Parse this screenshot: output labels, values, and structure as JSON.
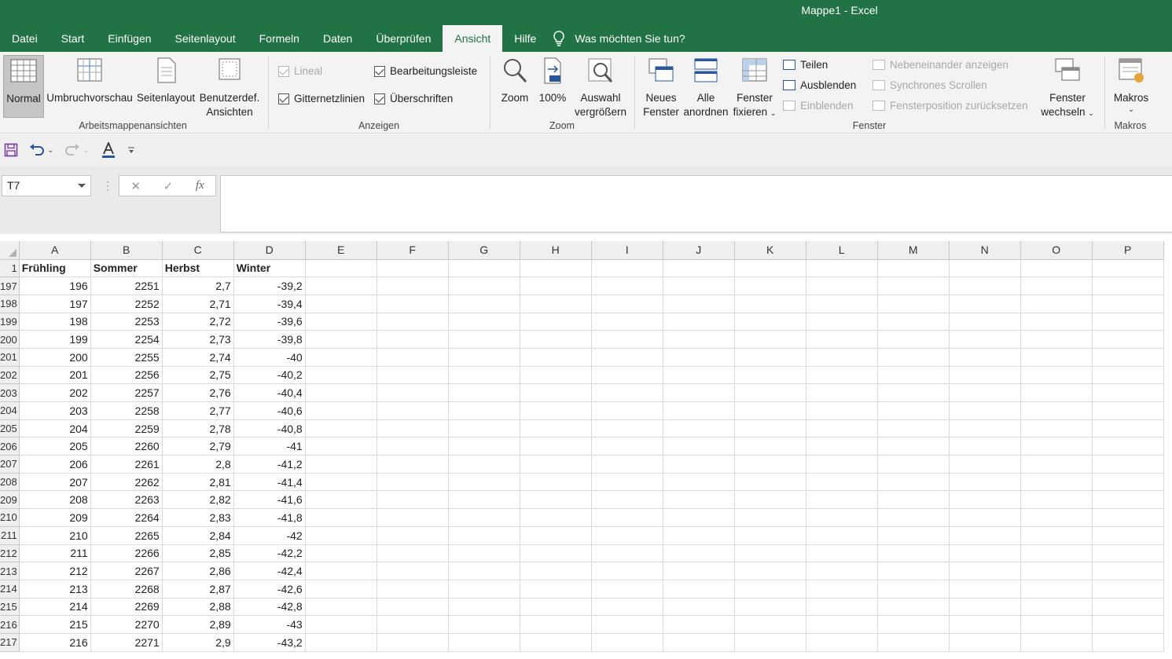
{
  "window": {
    "title": "Mappe1  -  Excel"
  },
  "tabs": [
    "Datei",
    "Start",
    "Einfügen",
    "Seitenlayout",
    "Formeln",
    "Daten",
    "Überprüfen",
    "Ansicht",
    "Hilfe"
  ],
  "active_tab": "Ansicht",
  "tell_me": "Was möchten Sie tun?",
  "ribbon": {
    "workbook_views": {
      "label": "Arbeitsmappenansichten",
      "normal": "Normal",
      "page_break": "Umbruchvorschau",
      "page_layout": "Seitenlayout",
      "custom_1": "Benutzerdef.",
      "custom_2": "Ansichten"
    },
    "show": {
      "label": "Anzeigen",
      "ruler": "Lineal",
      "gridlines": "Gitternetzlinien",
      "formula_bar": "Bearbeitungsleiste",
      "headings": "Überschriften"
    },
    "zoom": {
      "label": "Zoom",
      "zoom": "Zoom",
      "hundred": "100%",
      "selection_1": "Auswahl",
      "selection_2": "vergrößern"
    },
    "window": {
      "label": "Fenster",
      "new_1": "Neues",
      "new_2": "Fenster",
      "arrange_1": "Alle",
      "arrange_2": "anordnen",
      "freeze_1": "Fenster",
      "freeze_2": "fixieren",
      "split": "Teilen",
      "hide": "Ausblenden",
      "unhide": "Einblenden",
      "side_by_side": "Nebeneinander anzeigen",
      "sync_scroll": "Synchrones Scrollen",
      "reset_pos": "Fensterposition zurücksetzen",
      "switch_1": "Fenster",
      "switch_2": "wechseln"
    },
    "macros": {
      "label": "Makros",
      "button": "Makros"
    }
  },
  "formula_bar": {
    "name_box": "T7",
    "cancel": "✕",
    "enter": "✓",
    "fx": "fx",
    "value": ""
  },
  "columns": [
    "A",
    "B",
    "C",
    "D",
    "E",
    "F",
    "G",
    "H",
    "I",
    "J",
    "K",
    "L",
    "M",
    "N",
    "O",
    "P"
  ],
  "header_row": {
    "row": "1",
    "cells": [
      "Frühling",
      "Sommer",
      "Herbst",
      "Winter"
    ]
  },
  "rows": [
    {
      "row": "197",
      "cells": [
        "196",
        "2251",
        "2,7",
        "-39,2"
      ]
    },
    {
      "row": "198",
      "cells": [
        "197",
        "2252",
        "2,71",
        "-39,4"
      ]
    },
    {
      "row": "199",
      "cells": [
        "198",
        "2253",
        "2,72",
        "-39,6"
      ]
    },
    {
      "row": "200",
      "cells": [
        "199",
        "2254",
        "2,73",
        "-39,8"
      ]
    },
    {
      "row": "201",
      "cells": [
        "200",
        "2255",
        "2,74",
        "-40"
      ]
    },
    {
      "row": "202",
      "cells": [
        "201",
        "2256",
        "2,75",
        "-40,2"
      ]
    },
    {
      "row": "203",
      "cells": [
        "202",
        "2257",
        "2,76",
        "-40,4"
      ]
    },
    {
      "row": "204",
      "cells": [
        "203",
        "2258",
        "2,77",
        "-40,6"
      ]
    },
    {
      "row": "205",
      "cells": [
        "204",
        "2259",
        "2,78",
        "-40,8"
      ]
    },
    {
      "row": "206",
      "cells": [
        "205",
        "2260",
        "2,79",
        "-41"
      ]
    },
    {
      "row": "207",
      "cells": [
        "206",
        "2261",
        "2,8",
        "-41,2"
      ]
    },
    {
      "row": "208",
      "cells": [
        "207",
        "2262",
        "2,81",
        "-41,4"
      ]
    },
    {
      "row": "209",
      "cells": [
        "208",
        "2263",
        "2,82",
        "-41,6"
      ]
    },
    {
      "row": "210",
      "cells": [
        "209",
        "2264",
        "2,83",
        "-41,8"
      ]
    },
    {
      "row": "211",
      "cells": [
        "210",
        "2265",
        "2,84",
        "-42"
      ]
    },
    {
      "row": "212",
      "cells": [
        "211",
        "2266",
        "2,85",
        "-42,2"
      ]
    },
    {
      "row": "213",
      "cells": [
        "212",
        "2267",
        "2,86",
        "-42,4"
      ]
    },
    {
      "row": "214",
      "cells": [
        "213",
        "2268",
        "2,87",
        "-42,6"
      ]
    },
    {
      "row": "215",
      "cells": [
        "214",
        "2269",
        "2,88",
        "-42,8"
      ]
    },
    {
      "row": "216",
      "cells": [
        "215",
        "2270",
        "2,89",
        "-43"
      ]
    },
    {
      "row": "217",
      "cells": [
        "216",
        "2271",
        "2,9",
        "-43,2"
      ]
    }
  ],
  "colors": {
    "excel_green": "#217346",
    "ribbon_bg": "#f3f3f3",
    "grid_line": "#dadada"
  }
}
